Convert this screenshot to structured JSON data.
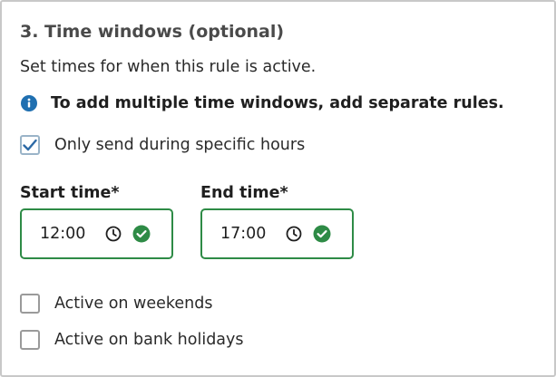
{
  "section": {
    "title": "3. Time windows (optional)",
    "description": "Set times for when this rule is active.",
    "info_text": "To add multiple time windows, add separate rules."
  },
  "specific_hours": {
    "label": "Only send during specific hours",
    "checked": true
  },
  "start_time": {
    "label": "Start time*",
    "value": "12:00",
    "valid": true
  },
  "end_time": {
    "label": "End time*",
    "value": "17:00",
    "valid": true
  },
  "weekends": {
    "label": "Active on weekends",
    "checked": false
  },
  "bank_holidays": {
    "label": "Active on bank holidays",
    "checked": false
  },
  "colors": {
    "valid_green": "#2e8b46",
    "info_blue": "#1f6fb0",
    "check_blue": "#2d6aa6"
  },
  "icons": {
    "info": "info-icon",
    "clock": "clock-icon",
    "valid": "check-circle-icon",
    "checkmark": "checkmark-icon"
  }
}
